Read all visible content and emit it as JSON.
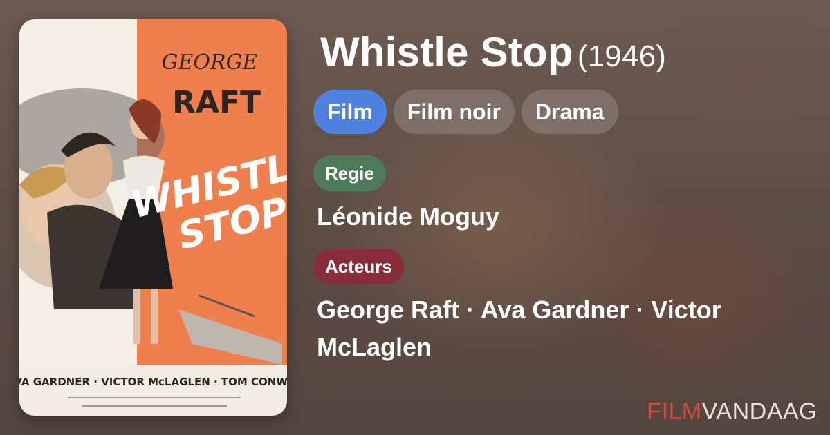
{
  "movie": {
    "title": "Whistle Stop",
    "year": "(1946)"
  },
  "genres": [
    "Film",
    "Film noir",
    "Drama"
  ],
  "director": {
    "label": "Regie",
    "name": "Léonide Moguy"
  },
  "cast": {
    "label": "Acteurs",
    "names": "George Raft · Ava Gardner · Victor McLaglen"
  },
  "brand": {
    "part1": "FILM",
    "part2": "VANDAAG"
  },
  "poster": {
    "top_line": "GEORGE",
    "star": "RAFT",
    "title_line1": "WHISTLE",
    "title_line2": "STOP",
    "cast_line": "AVA GARDNER · VICTOR McLAGLEN · TOM CONWAY"
  },
  "colors": {
    "film_pill": "#4f82e0",
    "regie_pill": "#4e7a59",
    "acteurs_pill": "#8a2d3a",
    "brand_red": "#d24c3e",
    "poster_orange": "#ef7f4d"
  }
}
